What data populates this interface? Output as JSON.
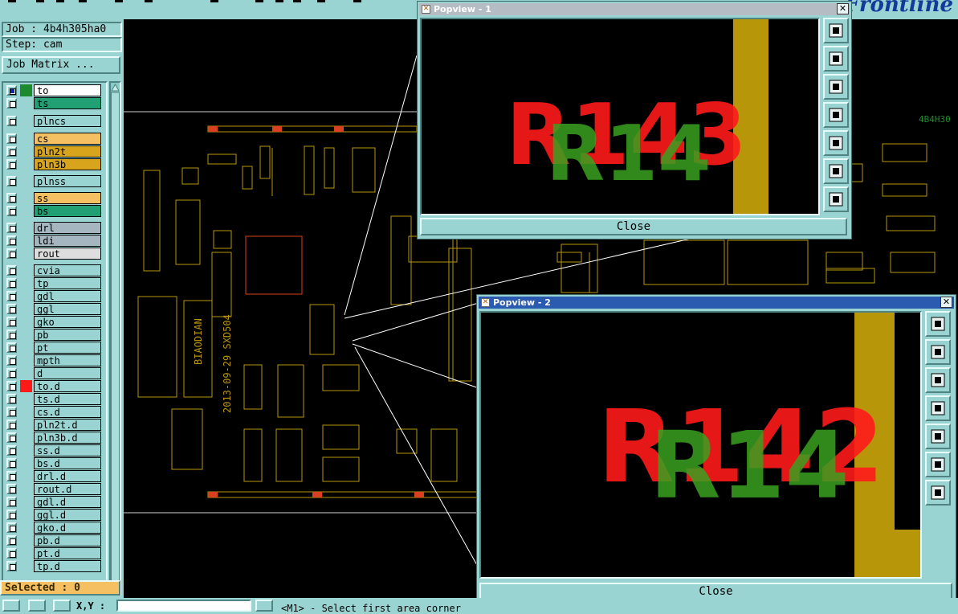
{
  "job": {
    "label": "Job : 4b4h305ha0",
    "step": "Step: cam"
  },
  "job_matrix_label": "Job Matrix ...",
  "layers": [
    {
      "name": "to",
      "color": "#1c8b2e",
      "name_bg": "#ffffff",
      "active": true
    },
    {
      "name": "ts",
      "color": "#9ad4d2",
      "name_bg": "#21a074"
    },
    {
      "name": "plncs",
      "color": "#9ad4d2",
      "name_bg": "#9ad4d2"
    },
    {
      "name": "cs",
      "color": "#9ad4d2",
      "name_bg": "#f5c061"
    },
    {
      "name": "pln2t",
      "color": "#9ad4d2",
      "name_bg": "#d8a41c"
    },
    {
      "name": "pln3b",
      "color": "#9ad4d2",
      "name_bg": "#d8a41c"
    },
    {
      "name": "plnss",
      "color": "#9ad4d2",
      "name_bg": "#9ad4d2"
    },
    {
      "name": "ss",
      "color": "#9ad4d2",
      "name_bg": "#f5c061"
    },
    {
      "name": "bs",
      "color": "#9ad4d2",
      "name_bg": "#21a074"
    },
    {
      "name": "drl",
      "color": "#9ad4d2",
      "name_bg": "#a6b6c0"
    },
    {
      "name": "ldi",
      "color": "#9ad4d2",
      "name_bg": "#a6b6c0"
    },
    {
      "name": "rout",
      "color": "#9ad4d2",
      "name_bg": "#dedede"
    },
    {
      "name": "cvia",
      "color": "#9ad4d2",
      "name_bg": "#9ad4d2"
    },
    {
      "name": "tp",
      "color": "#9ad4d2",
      "name_bg": "#9ad4d2"
    },
    {
      "name": "gdl",
      "color": "#9ad4d2",
      "name_bg": "#9ad4d2"
    },
    {
      "name": "ggl",
      "color": "#9ad4d2",
      "name_bg": "#9ad4d2"
    },
    {
      "name": "gko",
      "color": "#9ad4d2",
      "name_bg": "#9ad4d2"
    },
    {
      "name": "pb",
      "color": "#9ad4d2",
      "name_bg": "#9ad4d2"
    },
    {
      "name": "pt",
      "color": "#9ad4d2",
      "name_bg": "#9ad4d2"
    },
    {
      "name": "mpth",
      "color": "#9ad4d2",
      "name_bg": "#9ad4d2"
    },
    {
      "name": "d",
      "color": "#9ad4d2",
      "name_bg": "#9ad4d2"
    },
    {
      "name": "to.d",
      "color": "#ff1a1a",
      "name_bg": "#9ad4d2"
    },
    {
      "name": "ts.d",
      "color": "#9ad4d2",
      "name_bg": "#9ad4d2"
    },
    {
      "name": "cs.d",
      "color": "#9ad4d2",
      "name_bg": "#9ad4d2"
    },
    {
      "name": "pln2t.d",
      "color": "#9ad4d2",
      "name_bg": "#9ad4d2"
    },
    {
      "name": "pln3b.d",
      "color": "#9ad4d2",
      "name_bg": "#9ad4d2"
    },
    {
      "name": "ss.d",
      "color": "#9ad4d2",
      "name_bg": "#9ad4d2"
    },
    {
      "name": "bs.d",
      "color": "#9ad4d2",
      "name_bg": "#9ad4d2"
    },
    {
      "name": "drl.d",
      "color": "#9ad4d2",
      "name_bg": "#9ad4d2"
    },
    {
      "name": "rout.d",
      "color": "#9ad4d2",
      "name_bg": "#9ad4d2"
    },
    {
      "name": "gdl.d",
      "color": "#9ad4d2",
      "name_bg": "#9ad4d2"
    },
    {
      "name": "ggl.d",
      "color": "#9ad4d2",
      "name_bg": "#9ad4d2"
    },
    {
      "name": "gko.d",
      "color": "#9ad4d2",
      "name_bg": "#9ad4d2"
    },
    {
      "name": "pb.d",
      "color": "#9ad4d2",
      "name_bg": "#9ad4d2"
    },
    {
      "name": "pt.d",
      "color": "#9ad4d2",
      "name_bg": "#9ad4d2"
    },
    {
      "name": "tp.d",
      "color": "#9ad4d2",
      "name_bg": "#9ad4d2"
    }
  ],
  "selected_label": "Selected : 0",
  "board": {
    "silk_vertical_1": "BIAODIAN",
    "silk_vertical_2": "2013-09-29  SXD504",
    "job_tag": "4B4H30"
  },
  "popview1": {
    "title": "Popview - 1",
    "close_label": "Close",
    "title_bar_color": "#b6bcc4",
    "text_1": "R143",
    "text_2": "R14"
  },
  "popview2": {
    "title": "Popview - 2",
    "close_label": "Close",
    "title_bar_color": "#2a5bb0",
    "text_1": "R142",
    "text_2": "R14"
  },
  "status": {
    "xy_label": "X,Y :",
    "message": "<M1> - Select first area corner"
  },
  "colors": {
    "panel": "#9ad4d2",
    "copper": "#b8960a",
    "top_red": "#ff1a1a",
    "top_green": "#1c8b2e"
  }
}
